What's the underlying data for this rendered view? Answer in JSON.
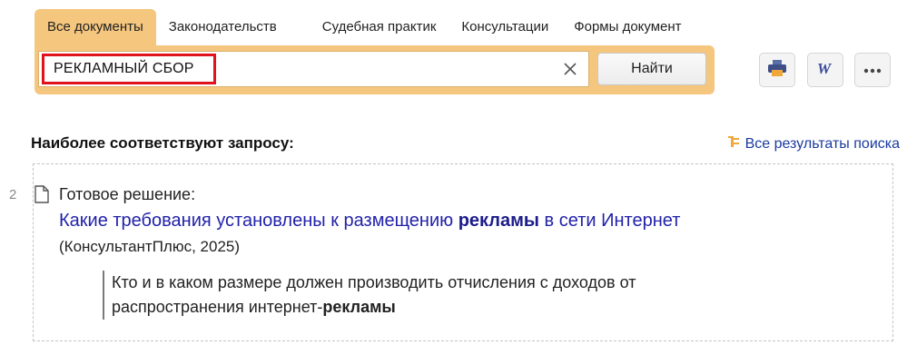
{
  "tabs": [
    {
      "label": "Все документы",
      "active": true
    },
    {
      "label": "Законодательств",
      "active": false
    },
    {
      "label": "Судебная практик",
      "active": false
    },
    {
      "label": "Консультации",
      "active": false
    },
    {
      "label": "Формы документ",
      "active": false
    }
  ],
  "search": {
    "value": "РЕКЛАМНЫЙ СБОР",
    "clear_icon": "close-icon",
    "button_label": "Найти"
  },
  "toolbar": {
    "print_icon": "print-icon",
    "word_icon": "word-icon",
    "more_icon": "more-icon"
  },
  "results": {
    "heading": "Наиболее соответствуют запросу:",
    "all_results_label": "Все результаты поиска",
    "items": [
      {
        "number": "2",
        "type_label": "Готовое решение:",
        "title_before": "Какие требования установлены к размещению ",
        "title_bold": "рекламы",
        "title_after": " в сети Интернет",
        "source": "(КонсультантПлюс, 2025)",
        "snippet_before": "Кто и в каком размере должен производить отчисления с доходов от распространения интернет-",
        "snippet_bold": "рекламы"
      }
    ]
  },
  "colors": {
    "tab_panel": "#f5c67e",
    "highlight_border": "#e0121b",
    "link": "#2222aa"
  }
}
